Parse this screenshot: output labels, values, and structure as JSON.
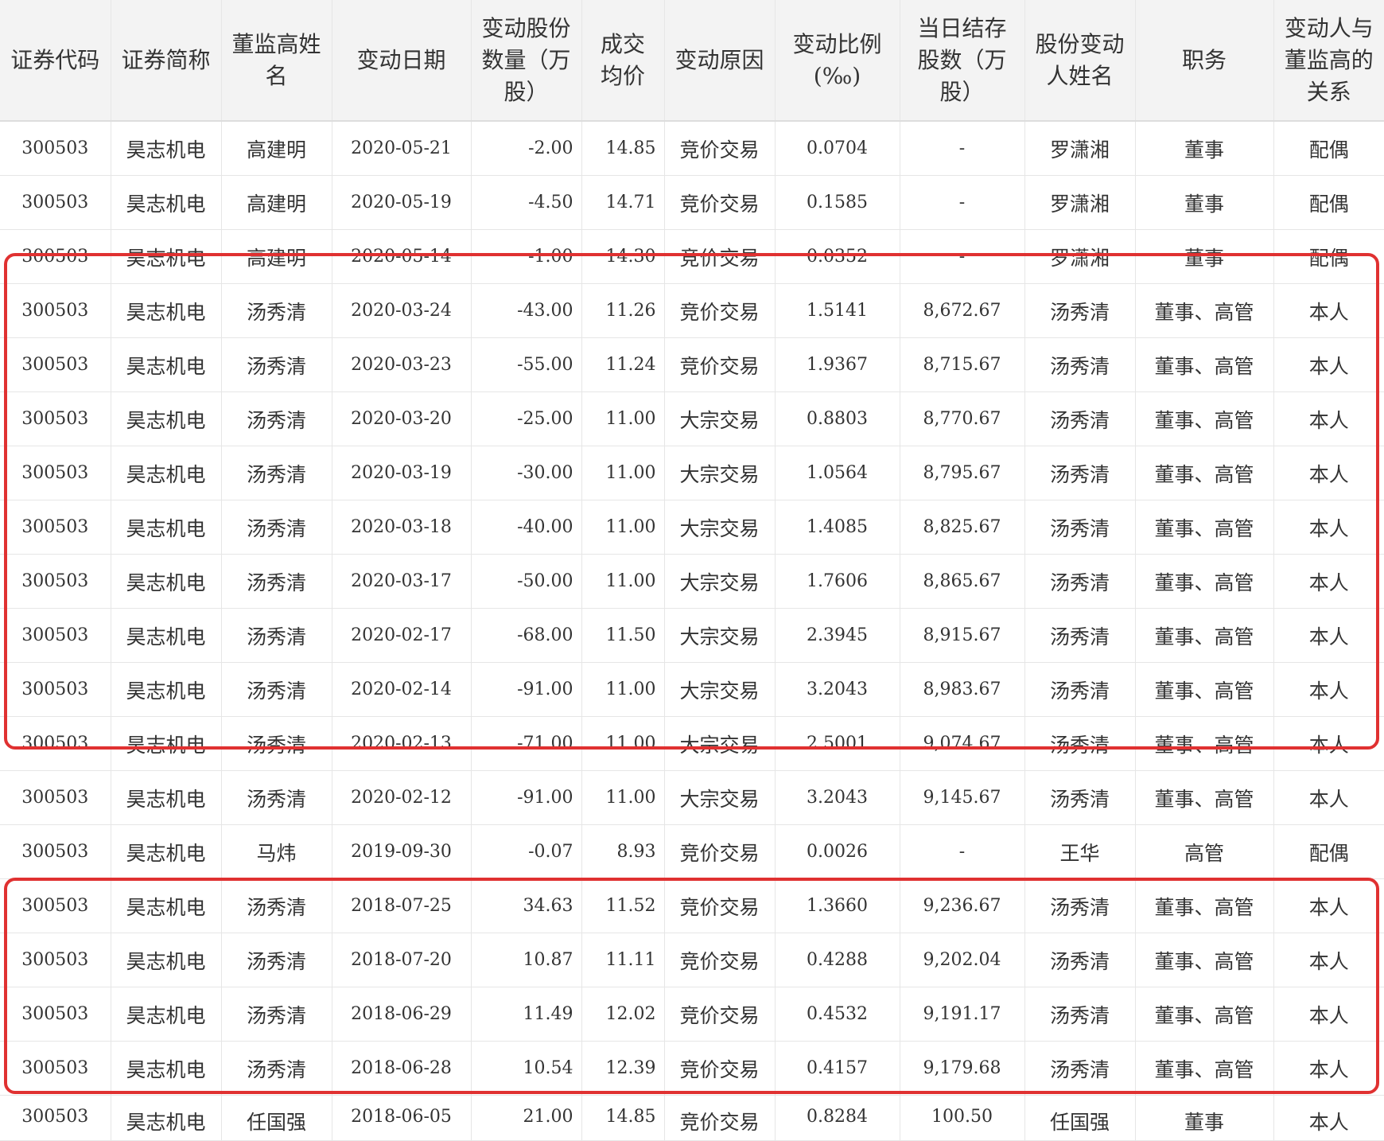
{
  "table": {
    "headers": [
      "证券代码",
      "证券简称",
      "董监高姓名",
      "变动日期",
      "变动股份数量（万股）",
      "成交均价",
      "变动原因",
      "变动比例(‰)",
      "当日结存股数（万股）",
      "股份变动人姓名",
      "职务",
      "变动人与董监高的关系"
    ],
    "rows": [
      [
        "300503",
        "昊志机电",
        "高建明",
        "2020-05-21",
        "-2.00",
        "14.85",
        "竞价交易",
        "0.0704",
        "-",
        "罗潇湘",
        "董事",
        "配偶"
      ],
      [
        "300503",
        "昊志机电",
        "高建明",
        "2020-05-19",
        "-4.50",
        "14.71",
        "竞价交易",
        "0.1585",
        "-",
        "罗潇湘",
        "董事",
        "配偶"
      ],
      [
        "300503",
        "昊志机电",
        "高建明",
        "2020-05-14",
        "-1.00",
        "14.30",
        "竞价交易",
        "0.0352",
        "-",
        "罗潇湘",
        "董事",
        "配偶"
      ],
      [
        "300503",
        "昊志机电",
        "汤秀清",
        "2020-03-24",
        "-43.00",
        "11.26",
        "竞价交易",
        "1.5141",
        "8,672.67",
        "汤秀清",
        "董事、高管",
        "本人"
      ],
      [
        "300503",
        "昊志机电",
        "汤秀清",
        "2020-03-23",
        "-55.00",
        "11.24",
        "竞价交易",
        "1.9367",
        "8,715.67",
        "汤秀清",
        "董事、高管",
        "本人"
      ],
      [
        "300503",
        "昊志机电",
        "汤秀清",
        "2020-03-20",
        "-25.00",
        "11.00",
        "大宗交易",
        "0.8803",
        "8,770.67",
        "汤秀清",
        "董事、高管",
        "本人"
      ],
      [
        "300503",
        "昊志机电",
        "汤秀清",
        "2020-03-19",
        "-30.00",
        "11.00",
        "大宗交易",
        "1.0564",
        "8,795.67",
        "汤秀清",
        "董事、高管",
        "本人"
      ],
      [
        "300503",
        "昊志机电",
        "汤秀清",
        "2020-03-18",
        "-40.00",
        "11.00",
        "大宗交易",
        "1.4085",
        "8,825.67",
        "汤秀清",
        "董事、高管",
        "本人"
      ],
      [
        "300503",
        "昊志机电",
        "汤秀清",
        "2020-03-17",
        "-50.00",
        "11.00",
        "大宗交易",
        "1.7606",
        "8,865.67",
        "汤秀清",
        "董事、高管",
        "本人"
      ],
      [
        "300503",
        "昊志机电",
        "汤秀清",
        "2020-02-17",
        "-68.00",
        "11.50",
        "大宗交易",
        "2.3945",
        "8,915.67",
        "汤秀清",
        "董事、高管",
        "本人"
      ],
      [
        "300503",
        "昊志机电",
        "汤秀清",
        "2020-02-14",
        "-91.00",
        "11.00",
        "大宗交易",
        "3.2043",
        "8,983.67",
        "汤秀清",
        "董事、高管",
        "本人"
      ],
      [
        "300503",
        "昊志机电",
        "汤秀清",
        "2020-02-13",
        "-71.00",
        "11.00",
        "大宗交易",
        "2.5001",
        "9,074.67",
        "汤秀清",
        "董事、高管",
        "本人"
      ],
      [
        "300503",
        "昊志机电",
        "汤秀清",
        "2020-02-12",
        "-91.00",
        "11.00",
        "大宗交易",
        "3.2043",
        "9,145.67",
        "汤秀清",
        "董事、高管",
        "本人"
      ],
      [
        "300503",
        "昊志机电",
        "马炜",
        "2019-09-30",
        "-0.07",
        "8.93",
        "竞价交易",
        "0.0026",
        "-",
        "王华",
        "高管",
        "配偶"
      ],
      [
        "300503",
        "昊志机电",
        "汤秀清",
        "2018-07-25",
        "34.63",
        "11.52",
        "竞价交易",
        "1.3660",
        "9,236.67",
        "汤秀清",
        "董事、高管",
        "本人"
      ],
      [
        "300503",
        "昊志机电",
        "汤秀清",
        "2018-07-20",
        "10.87",
        "11.11",
        "竞价交易",
        "0.4288",
        "9,202.04",
        "汤秀清",
        "董事、高管",
        "本人"
      ],
      [
        "300503",
        "昊志机电",
        "汤秀清",
        "2018-06-29",
        "11.49",
        "12.02",
        "竞价交易",
        "0.4532",
        "9,191.17",
        "汤秀清",
        "董事、高管",
        "本人"
      ],
      [
        "300503",
        "昊志机电",
        "汤秀清",
        "2018-06-28",
        "10.54",
        "12.39",
        "竞价交易",
        "0.4157",
        "9,179.68",
        "汤秀清",
        "董事、高管",
        "本人"
      ]
    ],
    "partial_row": [
      "300503",
      "昊志机电",
      "任国强",
      "2018-06-05",
      "21.00",
      "14.85",
      "竞价交易",
      "0.8284",
      "100.50",
      "任国强",
      "董事",
      "本人"
    ]
  },
  "highlight_color": "#e03131"
}
